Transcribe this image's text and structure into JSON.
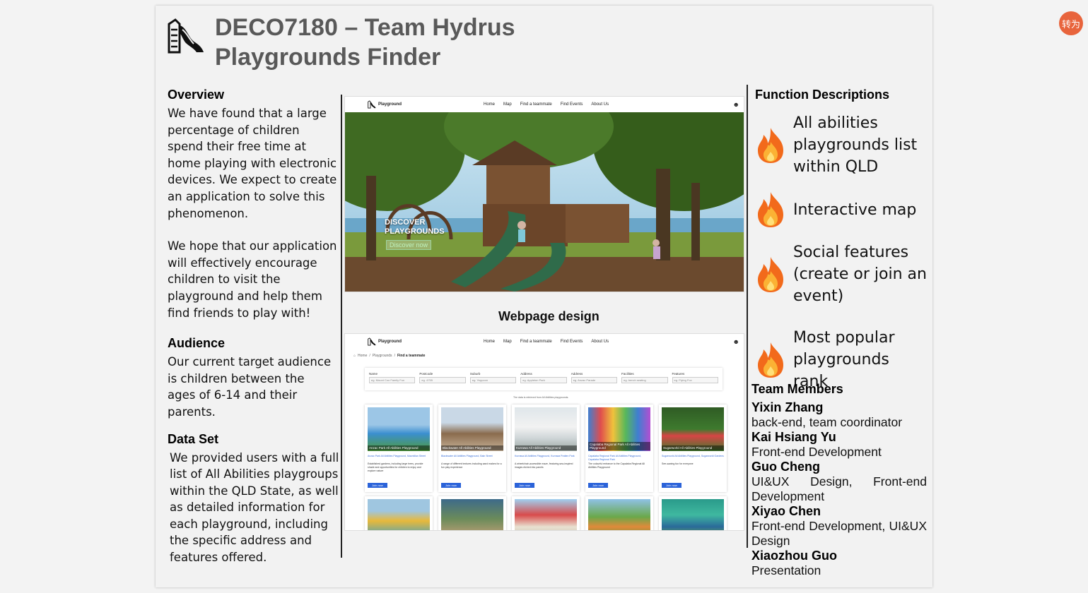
{
  "viewer": {
    "translate_label": "转为"
  },
  "header": {
    "title_line1": "DECO7180 – Team Hydrus",
    "title_line2": "Playgrounds Finder"
  },
  "overview": {
    "heading": "Overview",
    "para1": "We have found that a large percentage of children spend their free time at home playing with electronic devices. We expect to create an application to solve this phenomenon.",
    "para2": "We hope that our application will effectively encourage children to visit the playground and help them find friends to play with!"
  },
  "audience": {
    "heading": "Audience",
    "text": "Our current target audience is children between the ages of 6-14 and their parents."
  },
  "dataset": {
    "heading": "Data Set",
    "text": "We provided users with a full list of  All Abilities playgroups within the QLD State, as well as detailed information for each playground, including the specific address and features offered."
  },
  "webpage": {
    "caption": "Webpage design",
    "brand": "Playground",
    "nav_links": [
      "Home",
      "Map",
      "Find a teammate",
      "Find Events",
      "About Us"
    ],
    "hero_line1": "DISCOVER",
    "hero_line2": "PLAYGROUNDS",
    "hero_button": "Discover now",
    "breadcrumb": [
      "Home",
      "Playgrounds",
      "Find a teammate"
    ],
    "filters": [
      {
        "label": "Name",
        "placeholder": "eg. Mount Coo Family Fun"
      },
      {
        "label": "Postcode",
        "placeholder": "eg. 4755"
      },
      {
        "label": "Suburb",
        "placeholder": "eg. Yeppoon"
      },
      {
        "label": "Address",
        "placeholder": "eg. Appleton Park"
      },
      {
        "label": "Address",
        "placeholder": "eg. Anzac Parade"
      },
      {
        "label": "Facilities",
        "placeholder": "eg. bench seating"
      },
      {
        "label": "Features",
        "placeholder": "eg. Flying Fox"
      }
    ],
    "data_note": "The data is retrieved from All Abilities playgrounds.",
    "cards": [
      {
        "name": "Anzac Park All Abilities Playground",
        "address": "Anzac Park All Abilities Playground, Macmillan Street",
        "desc": "Established gardens, including large trees, provide shade and opportunities for children to enjoy and explore nature",
        "join": "Join now"
      },
      {
        "name": "Blackwater All Abilities Playground",
        "address": "Blackwater All Abilities Playground, Bain Street",
        "desc": "A range of different textures including sand makes for a fun play experience",
        "join": "Join now"
      },
      {
        "name": "Kurrawa All Abilities Playground",
        "address": "Kurrawa All Abilities Playground, Kurrawa Pratten Park",
        "desc": "A wheelchair-accessible maze, featuring sea-inspired images etched into panels",
        "join": "Join now"
      },
      {
        "name": "Capalaba Regional Park All Abilities Playground",
        "address": "Capalaba Regional Park All Abilities Playground, Capalaba Regional Park",
        "desc": "The colourful entrance to the Capalaba Regional All Abilities Playground",
        "join": "Join now"
      },
      {
        "name": "Sugarworld All Abilities Playground",
        "address": "Sugarworld All Abilities Playground, Sugarworld Gardens",
        "desc": "See-sawing fun for everyone",
        "join": "Join now"
      }
    ]
  },
  "functions": {
    "heading": "Function Descriptions",
    "items": [
      "All abilities playgrounds list within QLD",
      "Interactive map",
      "Social features (create or join an event)",
      "Most popular playgrounds rank"
    ]
  },
  "team": {
    "heading": "Team Members",
    "members": [
      {
        "name": "Yixin Zhang",
        "role": "back-end, team coordinator"
      },
      {
        "name": "Kai Hsiang Yu",
        "role": "Front-end Development"
      },
      {
        "name": "Guo Cheng",
        "role": "UI&UX Design, Front-end Development"
      },
      {
        "name": "Xiyao Chen",
        "role": "Front-end Development, UI&UX Design"
      },
      {
        "name": "Xiaozhou Guo",
        "role": "Presentation"
      }
    ]
  }
}
